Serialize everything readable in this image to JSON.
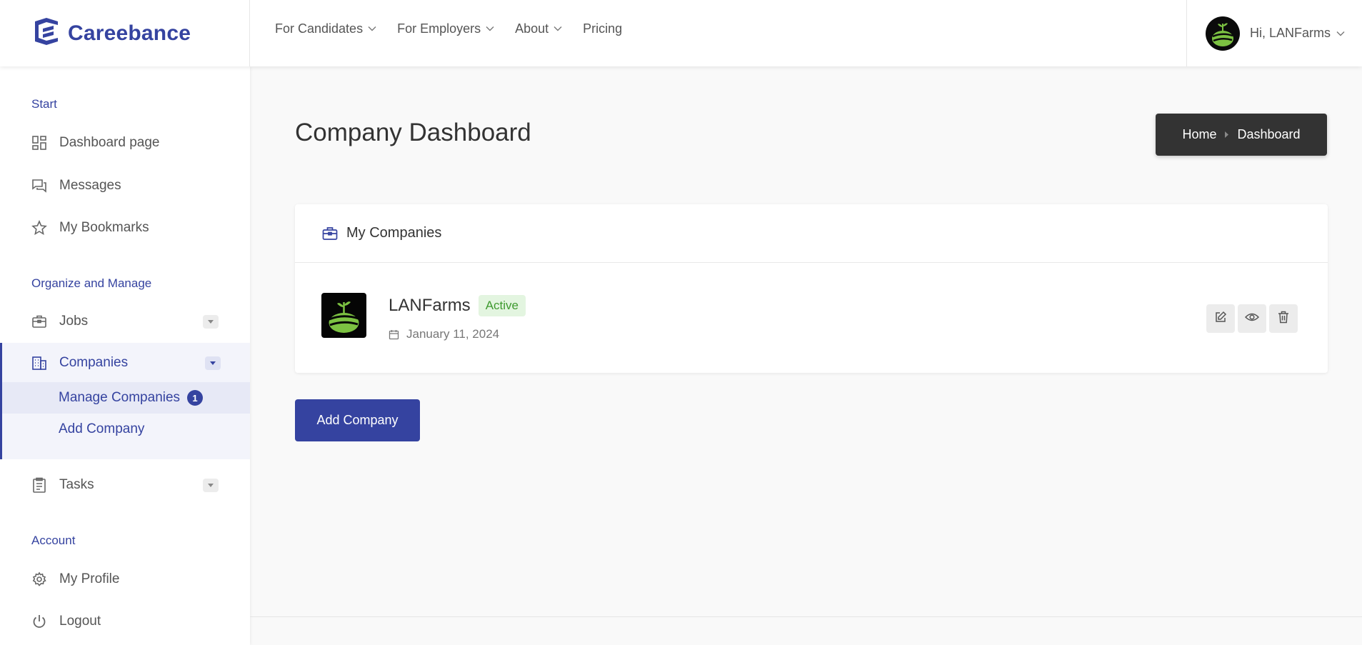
{
  "brand": {
    "name": "Careebance",
    "accent_color": "#3543a0"
  },
  "nav": {
    "items": [
      {
        "label": "For Candidates",
        "has_dropdown": true
      },
      {
        "label": "For Employers",
        "has_dropdown": true
      },
      {
        "label": "About",
        "has_dropdown": true
      },
      {
        "label": "Pricing",
        "has_dropdown": false
      }
    ]
  },
  "user": {
    "greeting": "Hi, LANFarms"
  },
  "sidebar": {
    "sections": [
      {
        "title": "Start",
        "items": [
          {
            "label": "Dashboard page",
            "icon": "dashboard-icon"
          },
          {
            "label": "Messages",
            "icon": "chat-icon"
          },
          {
            "label": "My Bookmarks",
            "icon": "star-icon"
          }
        ]
      },
      {
        "title": "Organize and Manage",
        "items": [
          {
            "label": "Jobs",
            "icon": "briefcase-icon"
          },
          {
            "label": "Companies",
            "icon": "building-icon",
            "active": true,
            "sub_items": [
              {
                "label": "Manage Companies",
                "badge": "1",
                "current": true
              },
              {
                "label": "Add Company"
              }
            ]
          },
          {
            "label": "Tasks",
            "icon": "clipboard-icon"
          }
        ]
      },
      {
        "title": "Account",
        "items": [
          {
            "label": "My Profile",
            "icon": "gear-icon"
          },
          {
            "label": "Logout",
            "icon": "power-icon"
          }
        ]
      }
    ]
  },
  "page": {
    "title": "Company Dashboard",
    "breadcrumb": [
      "Home",
      "Dashboard"
    ]
  },
  "companies_card": {
    "title": "My Companies",
    "companies": [
      {
        "name": "LANFarms",
        "status": "Active",
        "date": "January 11, 2024"
      }
    ]
  },
  "actions": {
    "add_company_label": "Add Company"
  },
  "colors": {
    "status_active_bg": "#e3f5e0",
    "status_active_text": "#3f9a30",
    "breadcrumb_bg": "#333333"
  }
}
